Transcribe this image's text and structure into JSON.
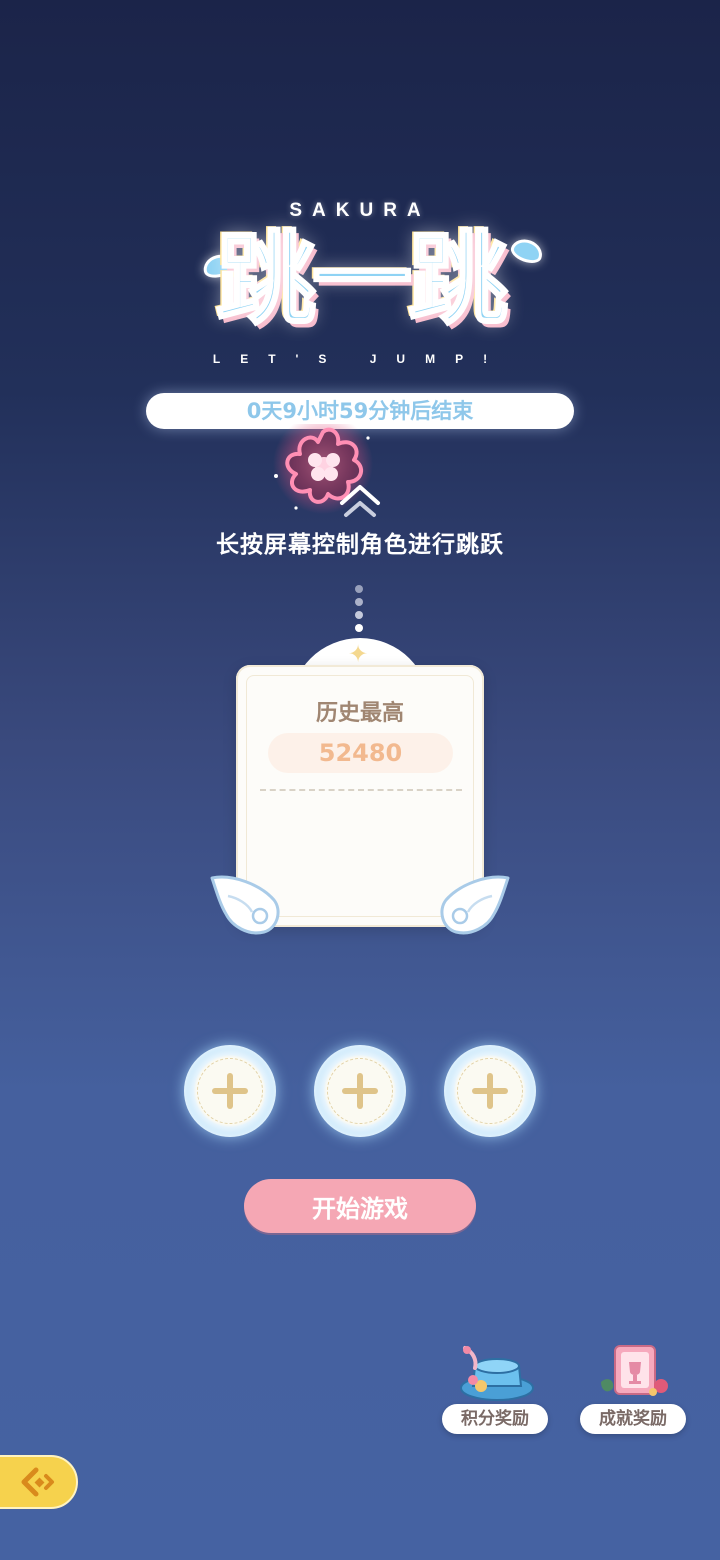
{
  "logo": {
    "top_text": "SAKURA",
    "title": "跳一跳",
    "subtitle": "LET'S JUMP!"
  },
  "timer": {
    "text": "0天9小时59分钟后结束"
  },
  "hint": {
    "text": "长按屏幕控制角色进行跳跃"
  },
  "score_card": {
    "label": "历史最高",
    "value": "52480"
  },
  "slots": [
    {
      "icon": "plus-icon"
    },
    {
      "icon": "plus-icon"
    },
    {
      "icon": "plus-icon"
    }
  ],
  "start_button": {
    "label": "开始游戏"
  },
  "rewards": [
    {
      "label": "积分奖励",
      "icon": "hat-icon"
    },
    {
      "label": "成就奖励",
      "icon": "trophy-book-icon"
    }
  ],
  "back_button": {
    "icon": "back-arrow-icon"
  },
  "colors": {
    "accent_pink": "#f5a7b4",
    "timer_text": "#8ec7ea",
    "score_text": "#f2b98f",
    "back_yellow": "#f6d24d"
  }
}
